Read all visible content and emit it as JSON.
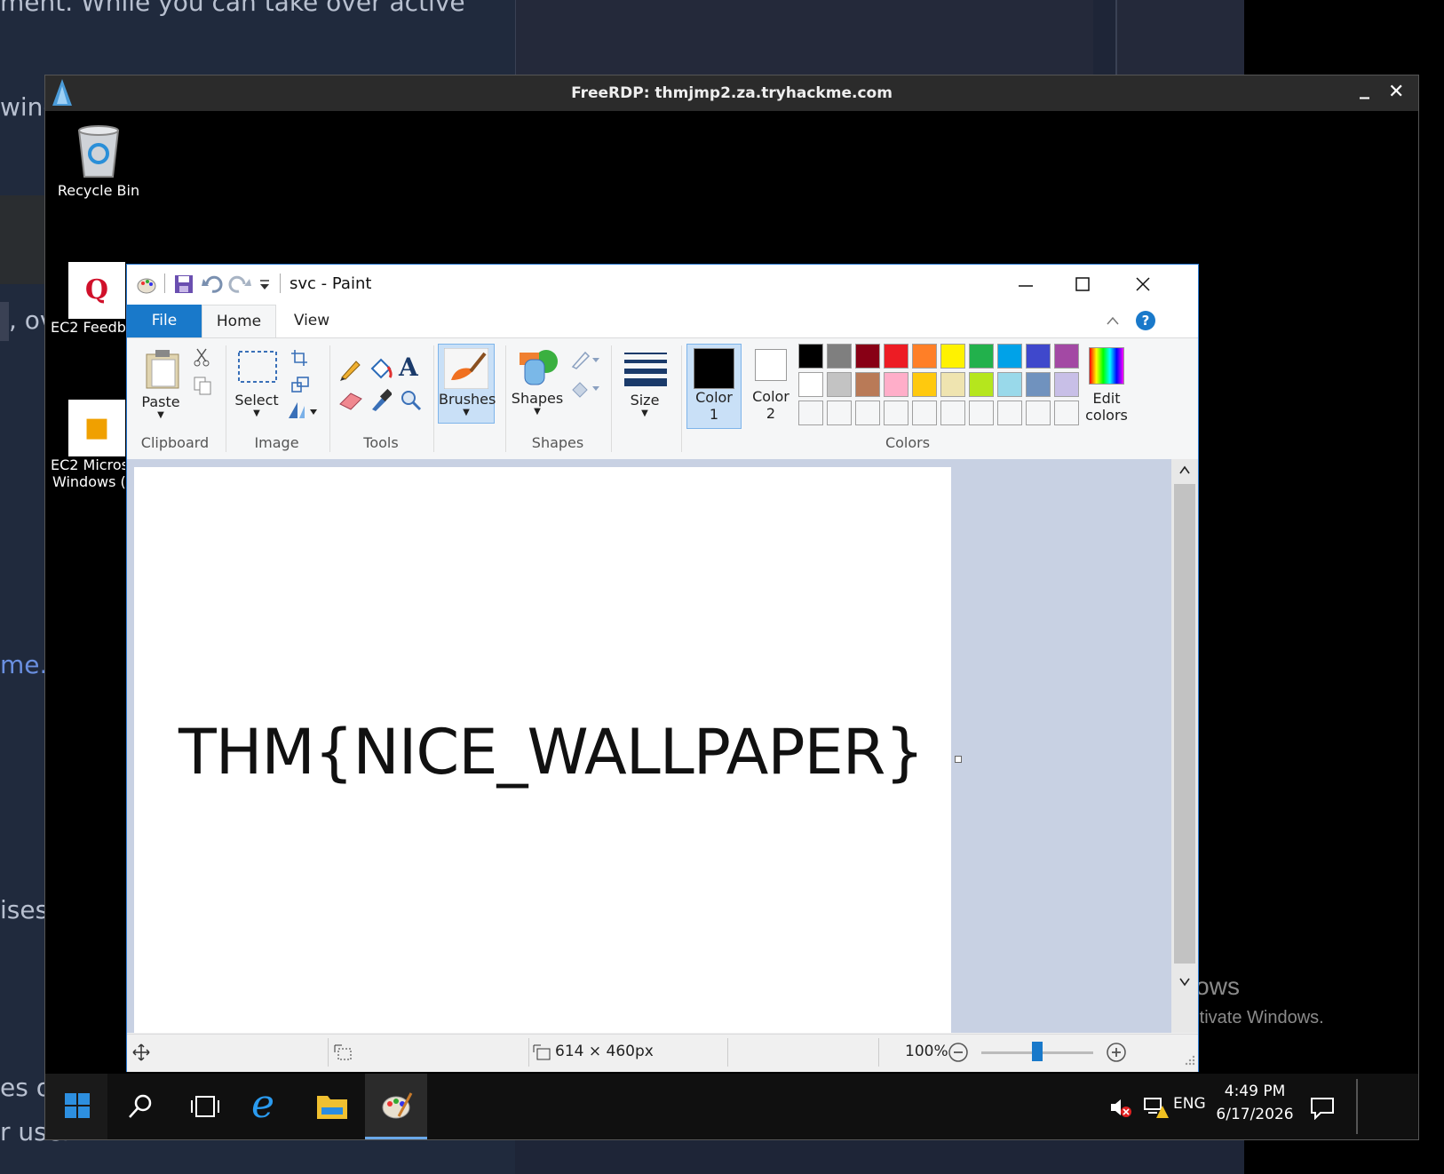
{
  "background_page": {
    "fragments": [
      "ment. While you can take over active",
      "wing",
      ", ov",
      "me.c",
      "ises",
      "es of",
      "r user"
    ]
  },
  "rdp": {
    "title": "FreeRDP: thmjmp2.za.tryhackme.com",
    "minimize": "_",
    "close": "✕"
  },
  "desktop": {
    "icons": [
      {
        "label": "Recycle Bin",
        "icon": "recycle-bin-icon"
      },
      {
        "label": "EC2 Feedb",
        "icon": "ec2-feedback-icon"
      },
      {
        "label": "EC2 Micros",
        "label2": "Windows (",
        "icon": "ec2-microsoft-icon"
      }
    ],
    "watermark_title": "Activate Windows",
    "watermark_sub": "Go to Settings to activate Windows."
  },
  "paint": {
    "title": "svc - Paint",
    "tabs": {
      "file": "File",
      "home": "Home",
      "view": "View"
    },
    "groups": {
      "clipboard": {
        "label": "Clipboard",
        "paste": "Paste"
      },
      "image": {
        "label": "Image",
        "select": "Select"
      },
      "tools": {
        "label": "Tools"
      },
      "brushes": {
        "label": "Brushes"
      },
      "shapes": {
        "label": "Shapes",
        "shapes_btn": "Shapes"
      },
      "size": {
        "label": "Size"
      },
      "color1": {
        "label": "Color",
        "num": "1"
      },
      "color2": {
        "label": "Color",
        "num": "2"
      },
      "colors": {
        "label": "Colors"
      },
      "edit_colors": {
        "line1": "Edit",
        "line2": "colors"
      }
    },
    "palette_row1": [
      "#000000",
      "#7f7f7f",
      "#880015",
      "#ed1c24",
      "#ff7f27",
      "#fff200",
      "#22b14c",
      "#00a2e8",
      "#3f48cc",
      "#a349a4"
    ],
    "palette_row2": [
      "#ffffff",
      "#c3c3c3",
      "#b97a57",
      "#ffaec9",
      "#ffc90e",
      "#efe4b0",
      "#b5e61d",
      "#99d9ea",
      "#7092be",
      "#c8bfe7"
    ],
    "canvas_text": "THM{NICE_WALLPAPER}",
    "status": {
      "image_size": "614 × 460px",
      "zoom": "100%",
      "zoom_level": 0.5
    }
  },
  "taskbar": {
    "lang": "ENG",
    "time": "4:49 PM",
    "date": "6/17/2026"
  }
}
